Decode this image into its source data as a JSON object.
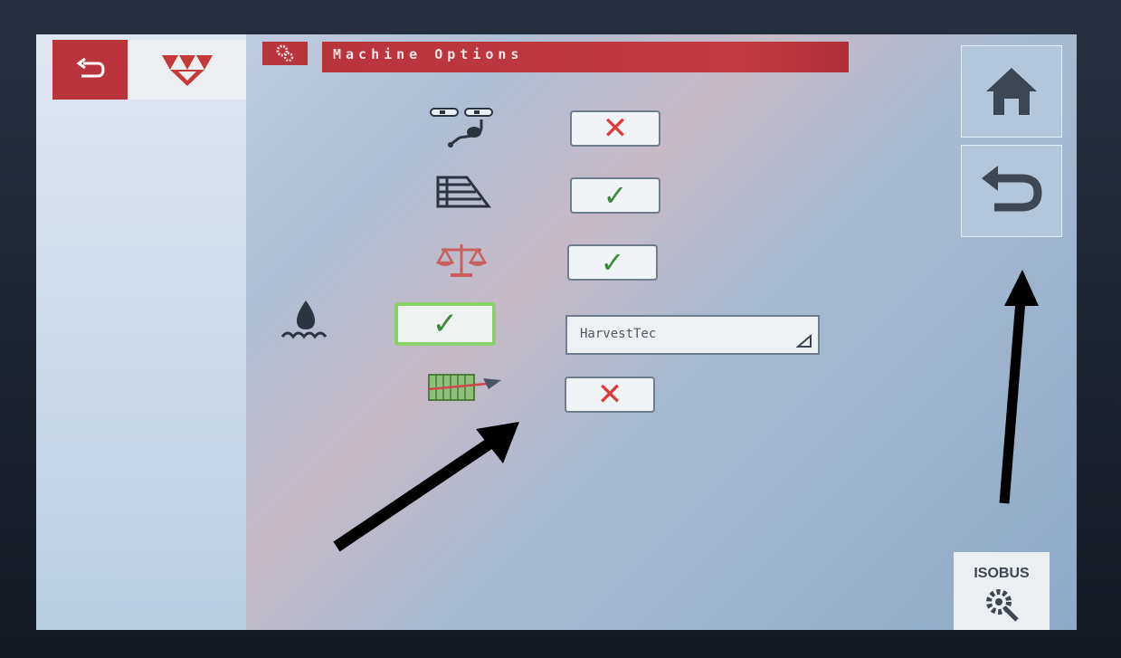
{
  "header": {
    "title": "Machine Options"
  },
  "options": [
    {
      "icon": "auger-spout-icon",
      "state": "disabled",
      "glyph": "✕"
    },
    {
      "icon": "crop-gate-icon",
      "state": "enabled",
      "glyph": "✓"
    },
    {
      "icon": "weigh-scale-icon",
      "state": "enabled",
      "glyph": "✓"
    },
    {
      "icon": "moisture-applicator-icon",
      "state": "enabled",
      "glyph": "✓",
      "selected": true
    },
    {
      "icon": "bale-marker-icon",
      "state": "disabled",
      "glyph": "✕"
    }
  ],
  "applicator": {
    "value": "HarvestTec"
  },
  "side": {
    "isobus_label": "ISOBUS"
  },
  "colors": {
    "accent_red": "#b9343b",
    "check_green": "#3e8a3a",
    "cross_red": "#e03a3a",
    "active_border": "#8bd06a"
  }
}
